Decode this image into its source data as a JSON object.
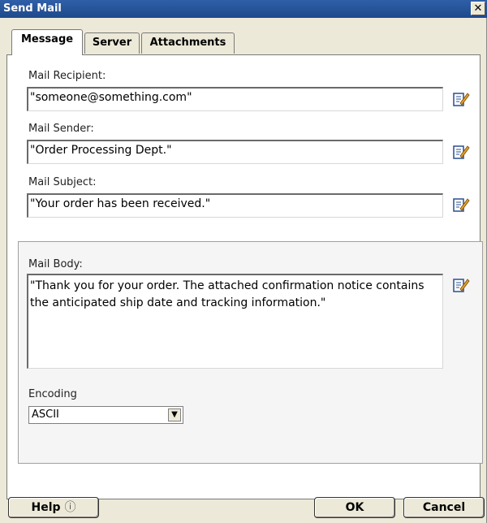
{
  "window": {
    "title": "Send Mail",
    "close_glyph": "✕"
  },
  "tabs": [
    {
      "label": "Message",
      "active": true
    },
    {
      "label": "Server",
      "active": false
    },
    {
      "label": "Attachments",
      "active": false
    }
  ],
  "fields": {
    "recipient": {
      "label": "Mail Recipient:",
      "value": "\"someone@something.com\""
    },
    "sender": {
      "label": "Mail Sender:",
      "value": "\"Order Processing Dept.\""
    },
    "subject": {
      "label": "Mail Subject:",
      "value": "\"Your order has been received.\""
    },
    "body": {
      "label": "Mail Body:",
      "value": "\"Thank you for your order. The attached confirmation notice contains the anticipated ship date and tracking information.\""
    }
  },
  "encoding": {
    "label": "Encoding",
    "selected": "ASCII"
  },
  "buttons": {
    "help": "Help",
    "help_icon": "ⓘ",
    "ok": "OK",
    "cancel": "Cancel"
  },
  "icons": {
    "edit": "edit-pencil-icon",
    "help": "question-circle-icon"
  },
  "colors": {
    "titlebar": "#1e4a8c",
    "dialog_bg": "#ece9d8"
  }
}
